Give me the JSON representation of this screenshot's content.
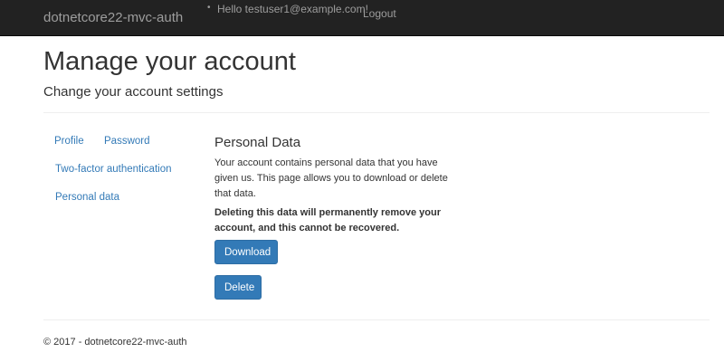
{
  "navbar": {
    "brand": "dotnetcore22-mvc-auth",
    "bullet": "•",
    "hello": "Hello testuser1@example.com!",
    "logout": "Logout"
  },
  "page": {
    "title": "Manage your account",
    "subtitle": "Change your account settings"
  },
  "sidebar": {
    "items": [
      {
        "label": "Profile"
      },
      {
        "label": "Password"
      },
      {
        "label": "Two-factor authentication"
      },
      {
        "label": "Personal data"
      }
    ]
  },
  "content": {
    "title": "Personal Data",
    "description": "Your account contains personal data that you have given us. This page allows you to download or delete that data.",
    "warning": "Deleting this data will permanently remove your account, and this cannot be recovered.",
    "download_label": "Download",
    "delete_label": "Delete"
  },
  "footer": {
    "text": "© 2017 - dotnetcore22-mvc-auth"
  },
  "colors": {
    "navbar_bg": "#222222",
    "link": "#337ab7",
    "button_primary": "#337ab7"
  }
}
